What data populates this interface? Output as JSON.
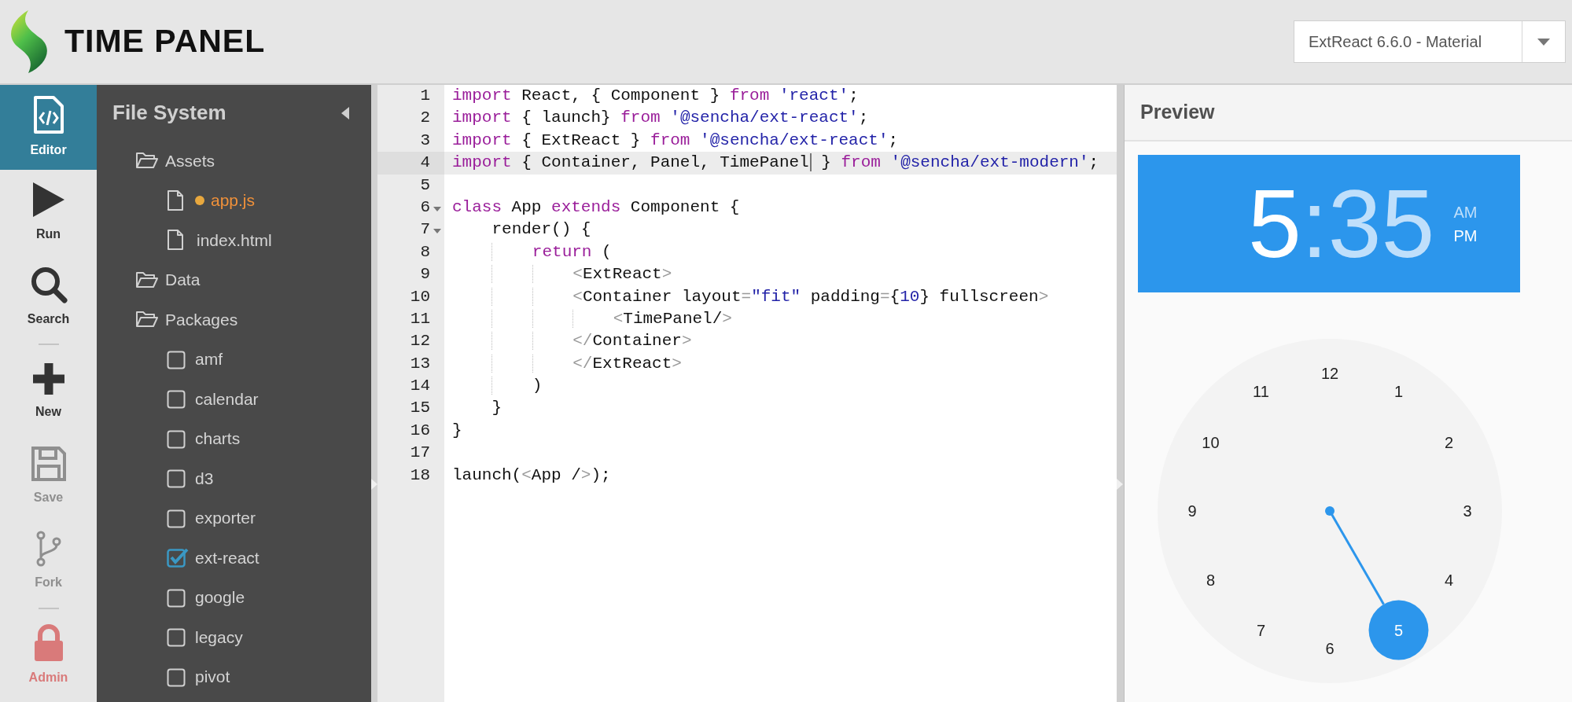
{
  "header": {
    "title": "TIME PANEL",
    "version_select": {
      "value": "ExtReact 6.6.0 - Material"
    }
  },
  "toolbar": {
    "groups": [
      [
        {
          "label": "Editor",
          "kind": "editor",
          "selected": true,
          "disabled": false
        },
        {
          "label": "Run",
          "kind": "run",
          "selected": false,
          "disabled": false
        },
        {
          "label": "Search",
          "kind": "search",
          "selected": false,
          "disabled": false
        }
      ],
      [
        {
          "label": "New",
          "kind": "new",
          "selected": false,
          "disabled": false
        },
        {
          "label": "Save",
          "kind": "save",
          "selected": false,
          "disabled": true
        },
        {
          "label": "Fork",
          "kind": "fork",
          "selected": false,
          "disabled": true
        }
      ],
      [
        {
          "label": "Admin",
          "kind": "admin",
          "selected": false,
          "disabled": true
        }
      ]
    ]
  },
  "file_tree": {
    "title": "File System",
    "items": [
      {
        "label": "Assets",
        "kind": "folder",
        "children": [
          {
            "label": "app.js",
            "kind": "file",
            "modified": true
          },
          {
            "label": "index.html",
            "kind": "file",
            "modified": false
          }
        ]
      },
      {
        "label": "Data",
        "kind": "folder"
      },
      {
        "label": "Packages",
        "kind": "folder",
        "children": [
          {
            "label": "amf",
            "kind": "package",
            "checked": false
          },
          {
            "label": "calendar",
            "kind": "package",
            "checked": false
          },
          {
            "label": "charts",
            "kind": "package",
            "checked": false
          },
          {
            "label": "d3",
            "kind": "package",
            "checked": false
          },
          {
            "label": "exporter",
            "kind": "package",
            "checked": false
          },
          {
            "label": "ext-react",
            "kind": "package",
            "checked": true
          },
          {
            "label": "google",
            "kind": "package",
            "checked": false
          },
          {
            "label": "legacy",
            "kind": "package",
            "checked": false
          },
          {
            "label": "pivot",
            "kind": "package",
            "checked": false
          }
        ]
      }
    ]
  },
  "editor": {
    "lines": [
      {
        "number": "1",
        "foldable": false,
        "current": false,
        "tokens": [
          {
            "kind": "keyword",
            "text": "import"
          },
          {
            "kind": "plain",
            "text": " React, { Component } "
          },
          {
            "kind": "keyword",
            "text": "from"
          },
          {
            "kind": "string",
            "text": " 'react'"
          },
          {
            "kind": "plain",
            "text": ";"
          }
        ]
      },
      {
        "number": "2",
        "foldable": false,
        "current": false,
        "tokens": [
          {
            "kind": "keyword",
            "text": "import"
          },
          {
            "kind": "plain",
            "text": " { launch} "
          },
          {
            "kind": "keyword",
            "text": "from"
          },
          {
            "kind": "string",
            "text": " '@sencha/ext-react'"
          },
          {
            "kind": "plain",
            "text": ";"
          }
        ]
      },
      {
        "number": "3",
        "foldable": false,
        "current": false,
        "tokens": [
          {
            "kind": "keyword",
            "text": "import"
          },
          {
            "kind": "plain",
            "text": " { ExtReact } "
          },
          {
            "kind": "keyword",
            "text": "from"
          },
          {
            "kind": "string",
            "text": " '@sencha/ext-react'"
          },
          {
            "kind": "plain",
            "text": ";"
          }
        ]
      },
      {
        "number": "4",
        "foldable": false,
        "current": true,
        "tokens": [
          {
            "kind": "keyword",
            "text": "import"
          },
          {
            "kind": "plain",
            "text": " { Container, Panel, TimePanel"
          },
          {
            "kind": "cursor"
          },
          {
            "kind": "plain",
            "text": " } "
          },
          {
            "kind": "keyword",
            "text": "from"
          },
          {
            "kind": "string",
            "text": " '@sencha/ext-modern'"
          },
          {
            "kind": "plain",
            "text": ";"
          }
        ]
      },
      {
        "number": "5",
        "foldable": false,
        "current": false
      },
      {
        "number": "6",
        "foldable": true,
        "current": false,
        "tokens": [
          {
            "kind": "keyword",
            "text": "class"
          },
          {
            "kind": "plain",
            "text": " App "
          },
          {
            "kind": "keyword",
            "text": "extends"
          },
          {
            "kind": "plain",
            "text": " Component {"
          }
        ]
      },
      {
        "number": "7",
        "foldable": true,
        "current": false,
        "tokens": [
          {
            "kind": "plain",
            "text": "    render() {"
          }
        ]
      },
      {
        "number": "8",
        "foldable": false,
        "current": false,
        "tokens": [
          {
            "kind": "keyword",
            "text": "        return"
          },
          {
            "kind": "plain",
            "text": " ("
          }
        ]
      },
      {
        "number": "9",
        "foldable": false,
        "current": false,
        "tokens": [
          {
            "kind": "bracket",
            "text": "            <"
          },
          {
            "kind": "plain",
            "text": "ExtReact"
          },
          {
            "kind": "bracket",
            "text": ">"
          }
        ]
      },
      {
        "number": "10",
        "foldable": false,
        "current": false,
        "tokens": [
          {
            "kind": "bracket",
            "text": "            <"
          },
          {
            "kind": "plain",
            "text": "Container layout"
          },
          {
            "kind": "bracket",
            "text": "="
          },
          {
            "kind": "string",
            "text": "\"fit\""
          },
          {
            "kind": "plain",
            "text": " padding"
          },
          {
            "kind": "bracket",
            "text": "="
          },
          {
            "kind": "plain",
            "text": "{"
          },
          {
            "kind": "number",
            "text": "10"
          },
          {
            "kind": "plain",
            "text": "} fullscreen"
          },
          {
            "kind": "bracket",
            "text": ">"
          }
        ]
      },
      {
        "number": "11",
        "foldable": false,
        "current": false,
        "tokens": [
          {
            "kind": "bracket",
            "text": "                <"
          },
          {
            "kind": "plain",
            "text": "TimePanel/"
          },
          {
            "kind": "bracket",
            "text": ">"
          }
        ]
      },
      {
        "number": "12",
        "foldable": false,
        "current": false,
        "tokens": [
          {
            "kind": "bracket",
            "text": "            </"
          },
          {
            "kind": "plain",
            "text": "Container"
          },
          {
            "kind": "bracket",
            "text": ">"
          }
        ]
      },
      {
        "number": "13",
        "foldable": false,
        "current": false,
        "tokens": [
          {
            "kind": "bracket",
            "text": "            </"
          },
          {
            "kind": "plain",
            "text": "ExtReact"
          },
          {
            "kind": "bracket",
            "text": ">"
          }
        ]
      },
      {
        "number": "14",
        "foldable": false,
        "current": false,
        "tokens": [
          {
            "kind": "plain",
            "text": "        )"
          }
        ]
      },
      {
        "number": "15",
        "foldable": false,
        "current": false,
        "tokens": [
          {
            "kind": "plain",
            "text": "    }"
          }
        ]
      },
      {
        "number": "16",
        "foldable": false,
        "current": false,
        "tokens": [
          {
            "kind": "plain",
            "text": "}"
          }
        ]
      },
      {
        "number": "17",
        "foldable": false,
        "current": false
      },
      {
        "number": "18",
        "foldable": false,
        "current": false,
        "tokens": [
          {
            "kind": "plain",
            "text": "launch("
          },
          {
            "kind": "bracket",
            "text": "<"
          },
          {
            "kind": "plain",
            "text": "App /"
          },
          {
            "kind": "bracket",
            "text": ">"
          },
          {
            "kind": "plain",
            "text": ");"
          }
        ]
      }
    ]
  },
  "preview": {
    "title": "Preview",
    "time_panel": {
      "hours": {
        "text": "5",
        "selected": true
      },
      "separator": ":",
      "minutes": {
        "text": "35",
        "selected": false
      },
      "periods": [
        {
          "text": "AM",
          "selected": false
        },
        {
          "text": "PM",
          "selected": true
        }
      ],
      "dial": {
        "numbers": [
          {
            "text": "12",
            "selected": false
          },
          {
            "text": "1",
            "selected": false
          },
          {
            "text": "2",
            "selected": false
          },
          {
            "text": "3",
            "selected": false
          },
          {
            "text": "4",
            "selected": false
          },
          {
            "text": "5",
            "selected": true
          },
          {
            "text": "6",
            "selected": false
          },
          {
            "text": "7",
            "selected": false
          },
          {
            "text": "8",
            "selected": false
          },
          {
            "text": "9",
            "selected": false
          },
          {
            "text": "10",
            "selected": false
          },
          {
            "text": "11",
            "selected": false
          }
        ]
      }
    }
  }
}
